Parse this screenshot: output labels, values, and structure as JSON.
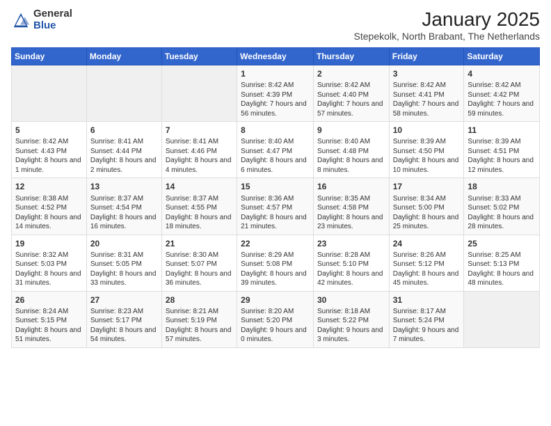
{
  "logo": {
    "general": "General",
    "blue": "Blue"
  },
  "title": "January 2025",
  "subtitle": "Stepekolk, North Brabant, The Netherlands",
  "weekdays": [
    "Sunday",
    "Monday",
    "Tuesday",
    "Wednesday",
    "Thursday",
    "Friday",
    "Saturday"
  ],
  "weeks": [
    [
      {
        "day": "",
        "content": ""
      },
      {
        "day": "",
        "content": ""
      },
      {
        "day": "",
        "content": ""
      },
      {
        "day": "1",
        "content": "Sunrise: 8:42 AM\nSunset: 4:39 PM\nDaylight: 7 hours and 56 minutes."
      },
      {
        "day": "2",
        "content": "Sunrise: 8:42 AM\nSunset: 4:40 PM\nDaylight: 7 hours and 57 minutes."
      },
      {
        "day": "3",
        "content": "Sunrise: 8:42 AM\nSunset: 4:41 PM\nDaylight: 7 hours and 58 minutes."
      },
      {
        "day": "4",
        "content": "Sunrise: 8:42 AM\nSunset: 4:42 PM\nDaylight: 7 hours and 59 minutes."
      }
    ],
    [
      {
        "day": "5",
        "content": "Sunrise: 8:42 AM\nSunset: 4:43 PM\nDaylight: 8 hours and 1 minute."
      },
      {
        "day": "6",
        "content": "Sunrise: 8:41 AM\nSunset: 4:44 PM\nDaylight: 8 hours and 2 minutes."
      },
      {
        "day": "7",
        "content": "Sunrise: 8:41 AM\nSunset: 4:46 PM\nDaylight: 8 hours and 4 minutes."
      },
      {
        "day": "8",
        "content": "Sunrise: 8:40 AM\nSunset: 4:47 PM\nDaylight: 8 hours and 6 minutes."
      },
      {
        "day": "9",
        "content": "Sunrise: 8:40 AM\nSunset: 4:48 PM\nDaylight: 8 hours and 8 minutes."
      },
      {
        "day": "10",
        "content": "Sunrise: 8:39 AM\nSunset: 4:50 PM\nDaylight: 8 hours and 10 minutes."
      },
      {
        "day": "11",
        "content": "Sunrise: 8:39 AM\nSunset: 4:51 PM\nDaylight: 8 hours and 12 minutes."
      }
    ],
    [
      {
        "day": "12",
        "content": "Sunrise: 8:38 AM\nSunset: 4:52 PM\nDaylight: 8 hours and 14 minutes."
      },
      {
        "day": "13",
        "content": "Sunrise: 8:37 AM\nSunset: 4:54 PM\nDaylight: 8 hours and 16 minutes."
      },
      {
        "day": "14",
        "content": "Sunrise: 8:37 AM\nSunset: 4:55 PM\nDaylight: 8 hours and 18 minutes."
      },
      {
        "day": "15",
        "content": "Sunrise: 8:36 AM\nSunset: 4:57 PM\nDaylight: 8 hours and 21 minutes."
      },
      {
        "day": "16",
        "content": "Sunrise: 8:35 AM\nSunset: 4:58 PM\nDaylight: 8 hours and 23 minutes."
      },
      {
        "day": "17",
        "content": "Sunrise: 8:34 AM\nSunset: 5:00 PM\nDaylight: 8 hours and 25 minutes."
      },
      {
        "day": "18",
        "content": "Sunrise: 8:33 AM\nSunset: 5:02 PM\nDaylight: 8 hours and 28 minutes."
      }
    ],
    [
      {
        "day": "19",
        "content": "Sunrise: 8:32 AM\nSunset: 5:03 PM\nDaylight: 8 hours and 31 minutes."
      },
      {
        "day": "20",
        "content": "Sunrise: 8:31 AM\nSunset: 5:05 PM\nDaylight: 8 hours and 33 minutes."
      },
      {
        "day": "21",
        "content": "Sunrise: 8:30 AM\nSunset: 5:07 PM\nDaylight: 8 hours and 36 minutes."
      },
      {
        "day": "22",
        "content": "Sunrise: 8:29 AM\nSunset: 5:08 PM\nDaylight: 8 hours and 39 minutes."
      },
      {
        "day": "23",
        "content": "Sunrise: 8:28 AM\nSunset: 5:10 PM\nDaylight: 8 hours and 42 minutes."
      },
      {
        "day": "24",
        "content": "Sunrise: 8:26 AM\nSunset: 5:12 PM\nDaylight: 8 hours and 45 minutes."
      },
      {
        "day": "25",
        "content": "Sunrise: 8:25 AM\nSunset: 5:13 PM\nDaylight: 8 hours and 48 minutes."
      }
    ],
    [
      {
        "day": "26",
        "content": "Sunrise: 8:24 AM\nSunset: 5:15 PM\nDaylight: 8 hours and 51 minutes."
      },
      {
        "day": "27",
        "content": "Sunrise: 8:23 AM\nSunset: 5:17 PM\nDaylight: 8 hours and 54 minutes."
      },
      {
        "day": "28",
        "content": "Sunrise: 8:21 AM\nSunset: 5:19 PM\nDaylight: 8 hours and 57 minutes."
      },
      {
        "day": "29",
        "content": "Sunrise: 8:20 AM\nSunset: 5:20 PM\nDaylight: 9 hours and 0 minutes."
      },
      {
        "day": "30",
        "content": "Sunrise: 8:18 AM\nSunset: 5:22 PM\nDaylight: 9 hours and 3 minutes."
      },
      {
        "day": "31",
        "content": "Sunrise: 8:17 AM\nSunset: 5:24 PM\nDaylight: 9 hours and 7 minutes."
      },
      {
        "day": "",
        "content": ""
      }
    ]
  ]
}
